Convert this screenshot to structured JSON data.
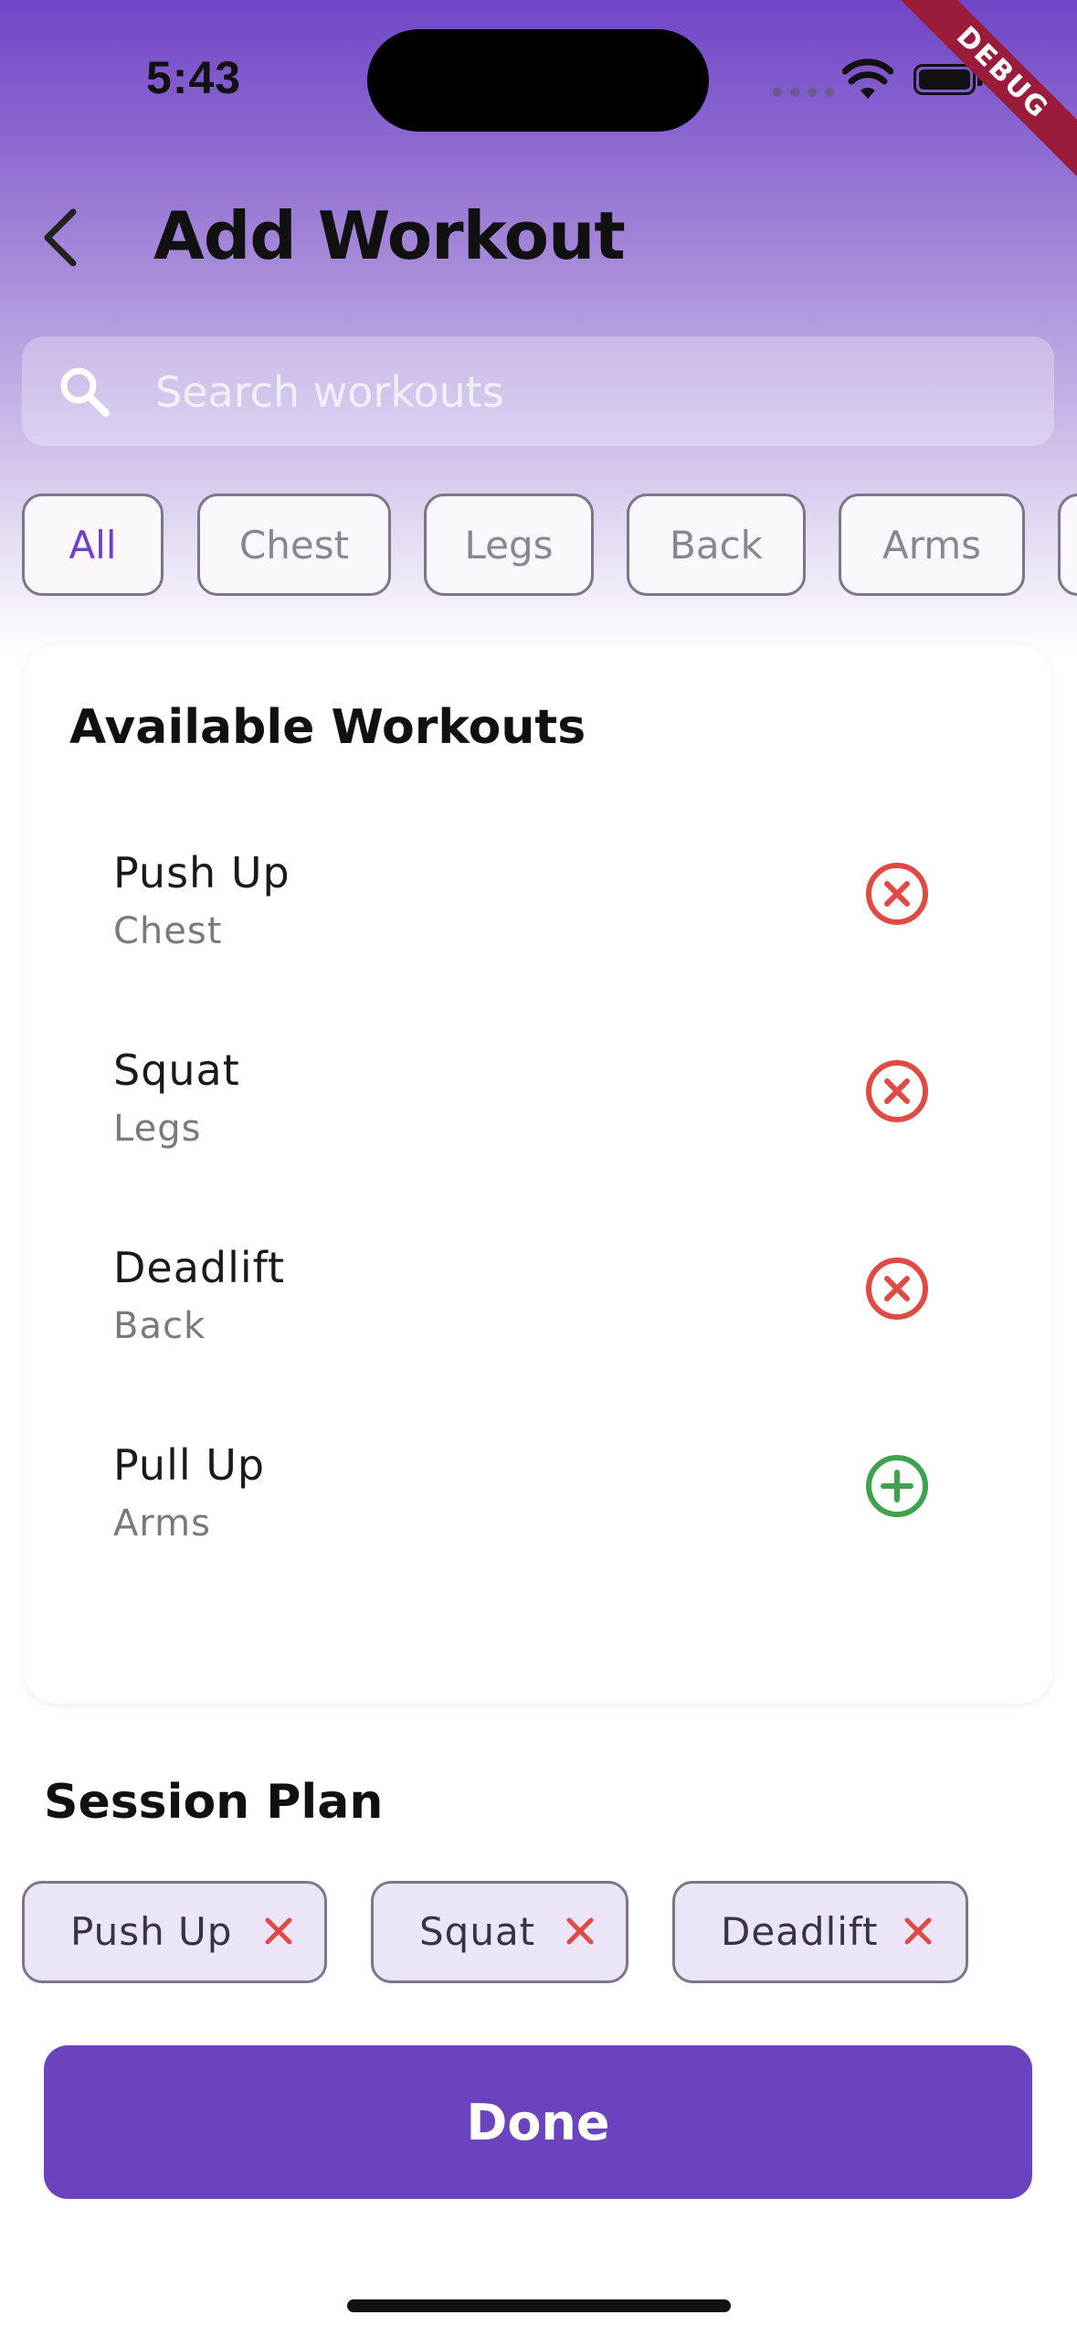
{
  "status_bar": {
    "time": "5:43",
    "debug_label": "DEBUG"
  },
  "header": {
    "title": "Add Workout"
  },
  "search": {
    "placeholder": "Search workouts"
  },
  "filters": [
    "All",
    "Chest",
    "Legs",
    "Back",
    "Arms"
  ],
  "available": {
    "title": "Available Workouts",
    "items": [
      {
        "name": "Push Up",
        "category": "Chest",
        "state": "added",
        "icon": "remove-circle-icon"
      },
      {
        "name": "Squat",
        "category": "Legs",
        "state": "added",
        "icon": "remove-circle-icon"
      },
      {
        "name": "Deadlift",
        "category": "Back",
        "state": "added",
        "icon": "remove-circle-icon"
      },
      {
        "name": "Pull Up",
        "category": "Arms",
        "state": "available",
        "icon": "add-circle-icon"
      }
    ]
  },
  "session_plan": {
    "title": "Session Plan",
    "items": [
      "Push Up",
      "Squat",
      "Deadlift"
    ]
  },
  "done_label": "Done",
  "colors": {
    "accent": "#6c43bf",
    "remove": "#e04a44",
    "add": "#3fa34d",
    "chip_active_text": "#6f3ec4"
  }
}
